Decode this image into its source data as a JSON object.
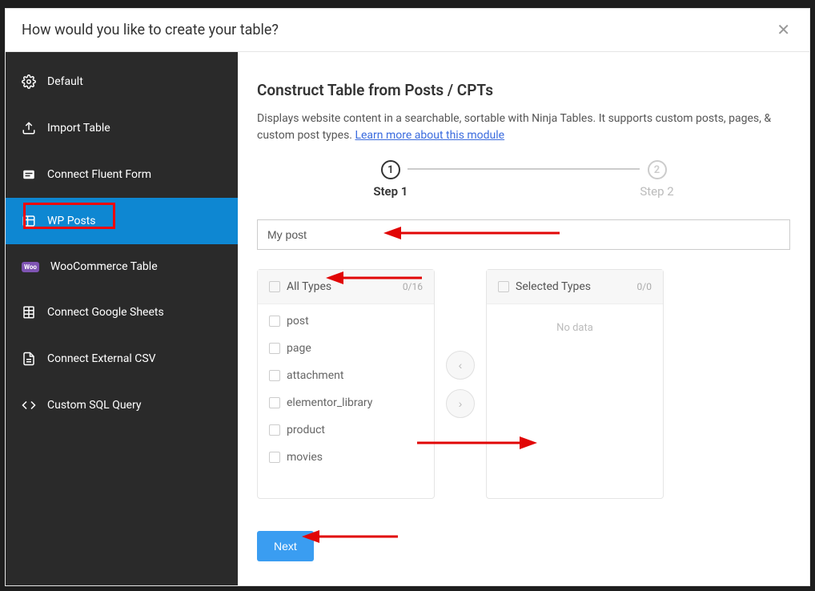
{
  "modal": {
    "title": "How would you like to create your table?"
  },
  "sidebar": {
    "items": [
      {
        "label": "Default"
      },
      {
        "label": "Import Table"
      },
      {
        "label": "Connect Fluent Form"
      },
      {
        "label": "WP Posts"
      },
      {
        "label": "WooCommerce Table"
      },
      {
        "label": "Connect Google Sheets"
      },
      {
        "label": "Connect External CSV"
      },
      {
        "label": "Custom SQL Query"
      }
    ]
  },
  "content": {
    "title": "Construct Table from Posts / CPTs",
    "description": "Displays website content in a searchable, sortable with Ninja Tables. It supports custom posts, pages, & custom post types.",
    "learn_more": "Learn more about this module",
    "steps": [
      {
        "num": "1",
        "label": "Step 1"
      },
      {
        "num": "2",
        "label": "Step 2"
      }
    ],
    "input_value": "My post",
    "all_types": {
      "title": "All Types",
      "count": "0/16",
      "items": [
        "post",
        "page",
        "attachment",
        "elementor_library",
        "product",
        "movies"
      ]
    },
    "selected_types": {
      "title": "Selected Types",
      "count": "0/0",
      "empty": "No data"
    },
    "next_button": "Next"
  }
}
